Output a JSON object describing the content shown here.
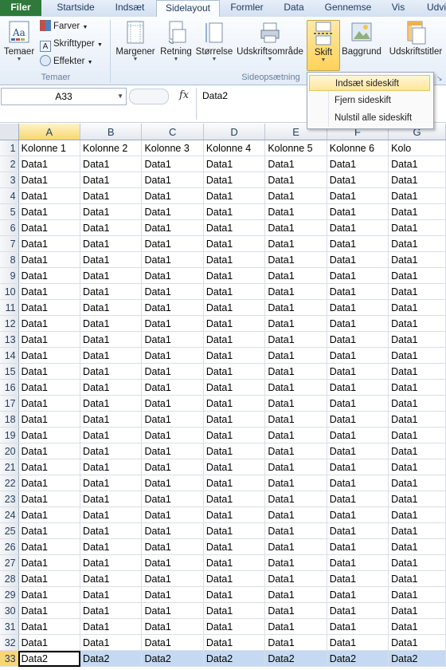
{
  "tabs": [
    "Filer",
    "Startside",
    "Indsæt",
    "Sidelayout",
    "Formler",
    "Data",
    "Gennemse",
    "Vis",
    "Udvi"
  ],
  "active_tab": "Sidelayout",
  "ribbon": {
    "themes": {
      "big": "Temaer",
      "colors": "Farver",
      "fonts": "Skrifttyper",
      "effects": "Effekter",
      "group_label": "Temaer"
    },
    "page_setup": {
      "margins": "Margener",
      "orientation": "Retning",
      "size": "Størrelse",
      "print_area": "Udskriftsområde",
      "breaks": "Skift",
      "background": "Baggrund",
      "print_titles": "Udskriftstitler",
      "group_label": "Sideopsætning"
    }
  },
  "breaks_menu": {
    "items": [
      "Indsæt sideskift",
      "Fjern sideskift",
      "Nulstil alle sideskift"
    ],
    "highlighted": "Indsæt sideskift"
  },
  "formula_bar": {
    "name_box": "A33",
    "fx": "fx",
    "content": "Data2"
  },
  "columns": [
    "A",
    "B",
    "C",
    "D",
    "E",
    "F",
    "G"
  ],
  "header_row": [
    "Kolonne 1",
    "Kolonne 2",
    "Kolonne 3",
    "Kolonne 4",
    "Kolonne 5",
    "Kolonne 6",
    "Kolo"
  ],
  "data1_label": "Data1",
  "data2_label": "Data2",
  "rows_data1": [
    2,
    3,
    4,
    5,
    6,
    7,
    8,
    9,
    10,
    11,
    12,
    13,
    14,
    15,
    16,
    17,
    18,
    19,
    20,
    21,
    22,
    23,
    24,
    25,
    26,
    27,
    28,
    29,
    30,
    31,
    32
  ],
  "selected_row": 33,
  "selected_row_label": "33"
}
